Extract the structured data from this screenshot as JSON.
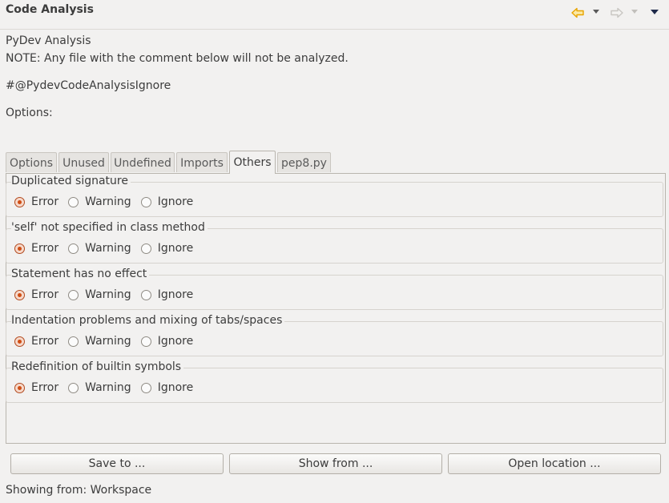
{
  "view": {
    "title": "Code Analysis",
    "toolbar": {
      "back_icon": "back-arrow-icon",
      "forward_icon": "forward-arrow-icon",
      "back_color": "#e8a400",
      "forward_color": "#c8c6c2",
      "menu_icon": "view-menu-icon"
    }
  },
  "intro": {
    "heading": "PyDev Analysis",
    "note": "NOTE: Any file with the comment below will not be analyzed.",
    "ignore_comment": "#@PydevCodeAnalysisIgnore",
    "options_label": "Options:"
  },
  "tabs": [
    {
      "label": "Options",
      "active": false
    },
    {
      "label": "Unused",
      "active": false
    },
    {
      "label": "Undefined",
      "active": false
    },
    {
      "label": "Imports",
      "active": false
    },
    {
      "label": "Others",
      "active": true
    },
    {
      "label": "pep8.py",
      "active": false
    }
  ],
  "groups": [
    {
      "label": "Duplicated signature",
      "options": [
        "Error",
        "Warning",
        "Ignore"
      ],
      "selected": "Error"
    },
    {
      "label": "'self' not specified in class method",
      "options": [
        "Error",
        "Warning",
        "Ignore"
      ],
      "selected": "Error"
    },
    {
      "label": "Statement has no effect",
      "options": [
        "Error",
        "Warning",
        "Ignore"
      ],
      "selected": "Error"
    },
    {
      "label": "Indentation problems and mixing of tabs/spaces",
      "options": [
        "Error",
        "Warning",
        "Ignore"
      ],
      "selected": "Error"
    },
    {
      "label": "Redefinition of builtin symbols",
      "options": [
        "Error",
        "Warning",
        "Ignore"
      ],
      "selected": "Error"
    }
  ],
  "buttons": {
    "save": "Save to ...",
    "show": "Show from ...",
    "open": "Open location ..."
  },
  "status": "Showing from: Workspace",
  "colors": {
    "accent": "#d04e14",
    "background": "#f2f1f0"
  }
}
